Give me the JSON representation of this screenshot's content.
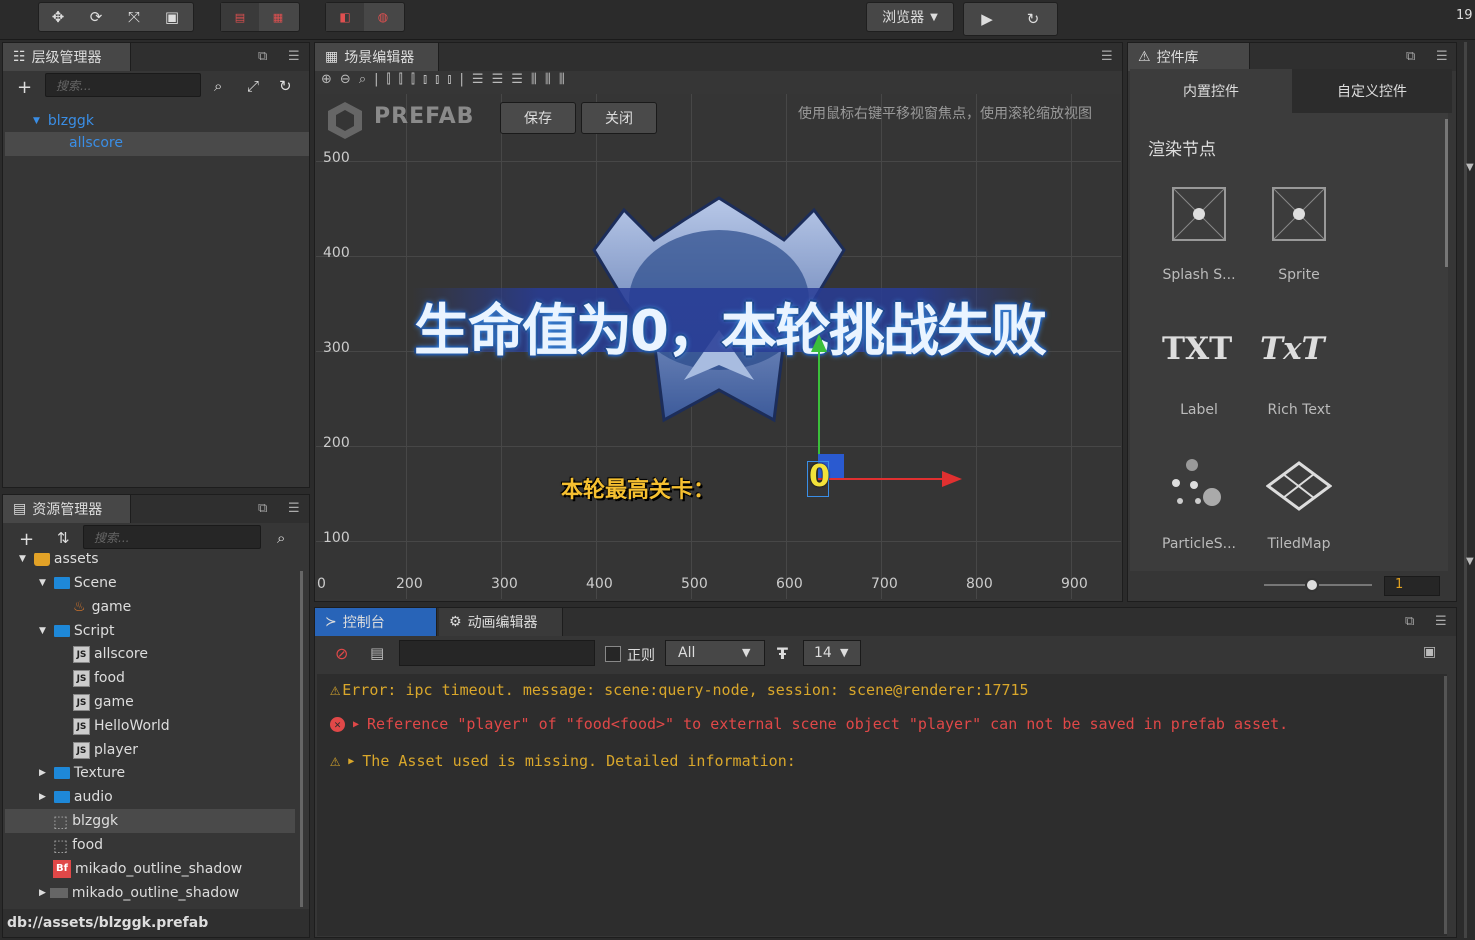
{
  "toolbar": {
    "browser_select": "浏览器",
    "top_right_text": "19"
  },
  "hierarchy": {
    "title": "层级管理器",
    "search_placeholder": "搜索...",
    "nodes": [
      {
        "label": "blzggk",
        "expanded": true
      },
      {
        "label": "allscore"
      }
    ]
  },
  "assets": {
    "title": "资源管理器",
    "search_placeholder": "搜索...",
    "items": [
      {
        "label": "assets",
        "type": "root"
      },
      {
        "label": "Scene",
        "type": "folder"
      },
      {
        "label": "game",
        "type": "scene"
      },
      {
        "label": "Script",
        "type": "folder"
      },
      {
        "label": "allscore",
        "type": "js"
      },
      {
        "label": "food",
        "type": "js"
      },
      {
        "label": "game",
        "type": "js"
      },
      {
        "label": "HelloWorld",
        "type": "js"
      },
      {
        "label": "player",
        "type": "js"
      },
      {
        "label": "Texture",
        "type": "folder"
      },
      {
        "label": "audio",
        "type": "folder"
      },
      {
        "label": "blzggk",
        "type": "prefab"
      },
      {
        "label": "food",
        "type": "prefab"
      },
      {
        "label": "mikado_outline_shadow",
        "type": "bitmapfont",
        "badge": "Bf"
      },
      {
        "label": "mikado_outline_shadow",
        "type": "texture"
      }
    ],
    "path": "db://assets/blzggk.prefab"
  },
  "scene": {
    "title": "场景编辑器",
    "prefab_label": "PREFAB",
    "save_label": "保存",
    "close_label": "关闭",
    "hint": "使用鼠标右键平移视窗焦点，使用滚轮缩放视图",
    "y_labels": [
      "500",
      "400",
      "300",
      "200",
      "100"
    ],
    "x_labels": [
      "0",
      "200",
      "300",
      "400",
      "500",
      "600",
      "700",
      "800",
      "900"
    ],
    "banner_text": "生命值为0，本轮挑战失败",
    "score_label": "本轮最高关卡：",
    "score_value": "0"
  },
  "widgets": {
    "title": "控件库",
    "tab_builtin": "内置控件",
    "tab_custom": "自定义控件",
    "section": "渲染节点",
    "items": [
      {
        "label": "Splash S...",
        "icon": "splash-sprite-icon"
      },
      {
        "label": "Sprite",
        "icon": "sprite-icon"
      },
      {
        "label": "Label",
        "icon": "label-icon",
        "glyph": "TXT"
      },
      {
        "label": "Rich Text",
        "icon": "richtext-icon",
        "glyph": "TxT"
      },
      {
        "label": "ParticleS...",
        "icon": "particle-icon"
      },
      {
        "label": "TiledMap",
        "icon": "tiledmap-icon"
      }
    ],
    "zoom_value": "1"
  },
  "console": {
    "tab_console": "控制台",
    "tab_anim": "动画编辑器",
    "regex_label": "正则",
    "filter_value": "All",
    "font_size": "14",
    "logs": [
      {
        "level": "warning",
        "text": "Error: ipc timeout. message: scene:query-node, session: scene@renderer:17715"
      },
      {
        "level": "error",
        "text": "Reference \"player\" of \"food<food>\" to external scene object \"player\" can not be saved in prefab asset."
      },
      {
        "level": "warning",
        "text": "The Asset used is missing. Detailed information:"
      }
    ]
  },
  "colors": {
    "accent_blue": "#3a8ee6",
    "error_red": "#e04848",
    "warning_yellow": "#d9a72b"
  }
}
